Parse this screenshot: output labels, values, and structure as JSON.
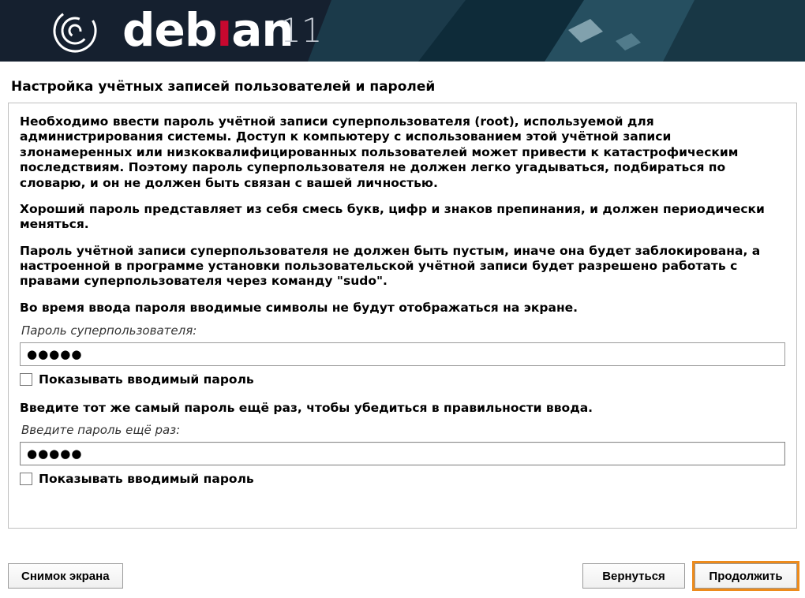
{
  "banner": {
    "brand_prefix": "deb",
    "brand_dotless_i": "ı",
    "brand_suffix": "an",
    "version": "11"
  },
  "page_title": "Настройка учётных записей пользователей и паролей",
  "instructions": {
    "p1": "Необходимо ввести пароль учётной записи суперпользователя (root), используемой для администрирования системы. Доступ к компьютеру с использованием этой учётной записи злонамеренных или низкоквалифицированных пользователей может привести к катастрофическим последствиям. Поэтому пароль суперпользователя не должен легко угадываться, подбираться по словарю, и он не должен быть связан с вашей личностью.",
    "p2": "Хороший пароль представляет из себя смесь букв, цифр и знаков препинания, и должен периодически меняться.",
    "p3": "Пароль учётной записи суперпользователя не должен быть пустым, иначе она будет заблокирована, а настроенной в программе установки пользовательской учётной записи будет разрешено работать с правами суперпользователя через команду \"sudo\".",
    "p4": "Во время ввода пароля вводимые символы не будут отображаться на экране."
  },
  "field1": {
    "label": "Пароль суперпользователя:",
    "value": "●●●●●",
    "show_label": "Показывать вводимый пароль"
  },
  "confirm_prompt": "Введите тот же самый пароль ещё раз, чтобы убедиться в правильности ввода.",
  "field2": {
    "label": "Введите пароль ещё раз:",
    "value": "●●●●●",
    "show_label": "Показывать вводимый пароль"
  },
  "buttons": {
    "screenshot": "Снимок экрана",
    "back": "Вернуться",
    "continue": "Продолжить"
  }
}
